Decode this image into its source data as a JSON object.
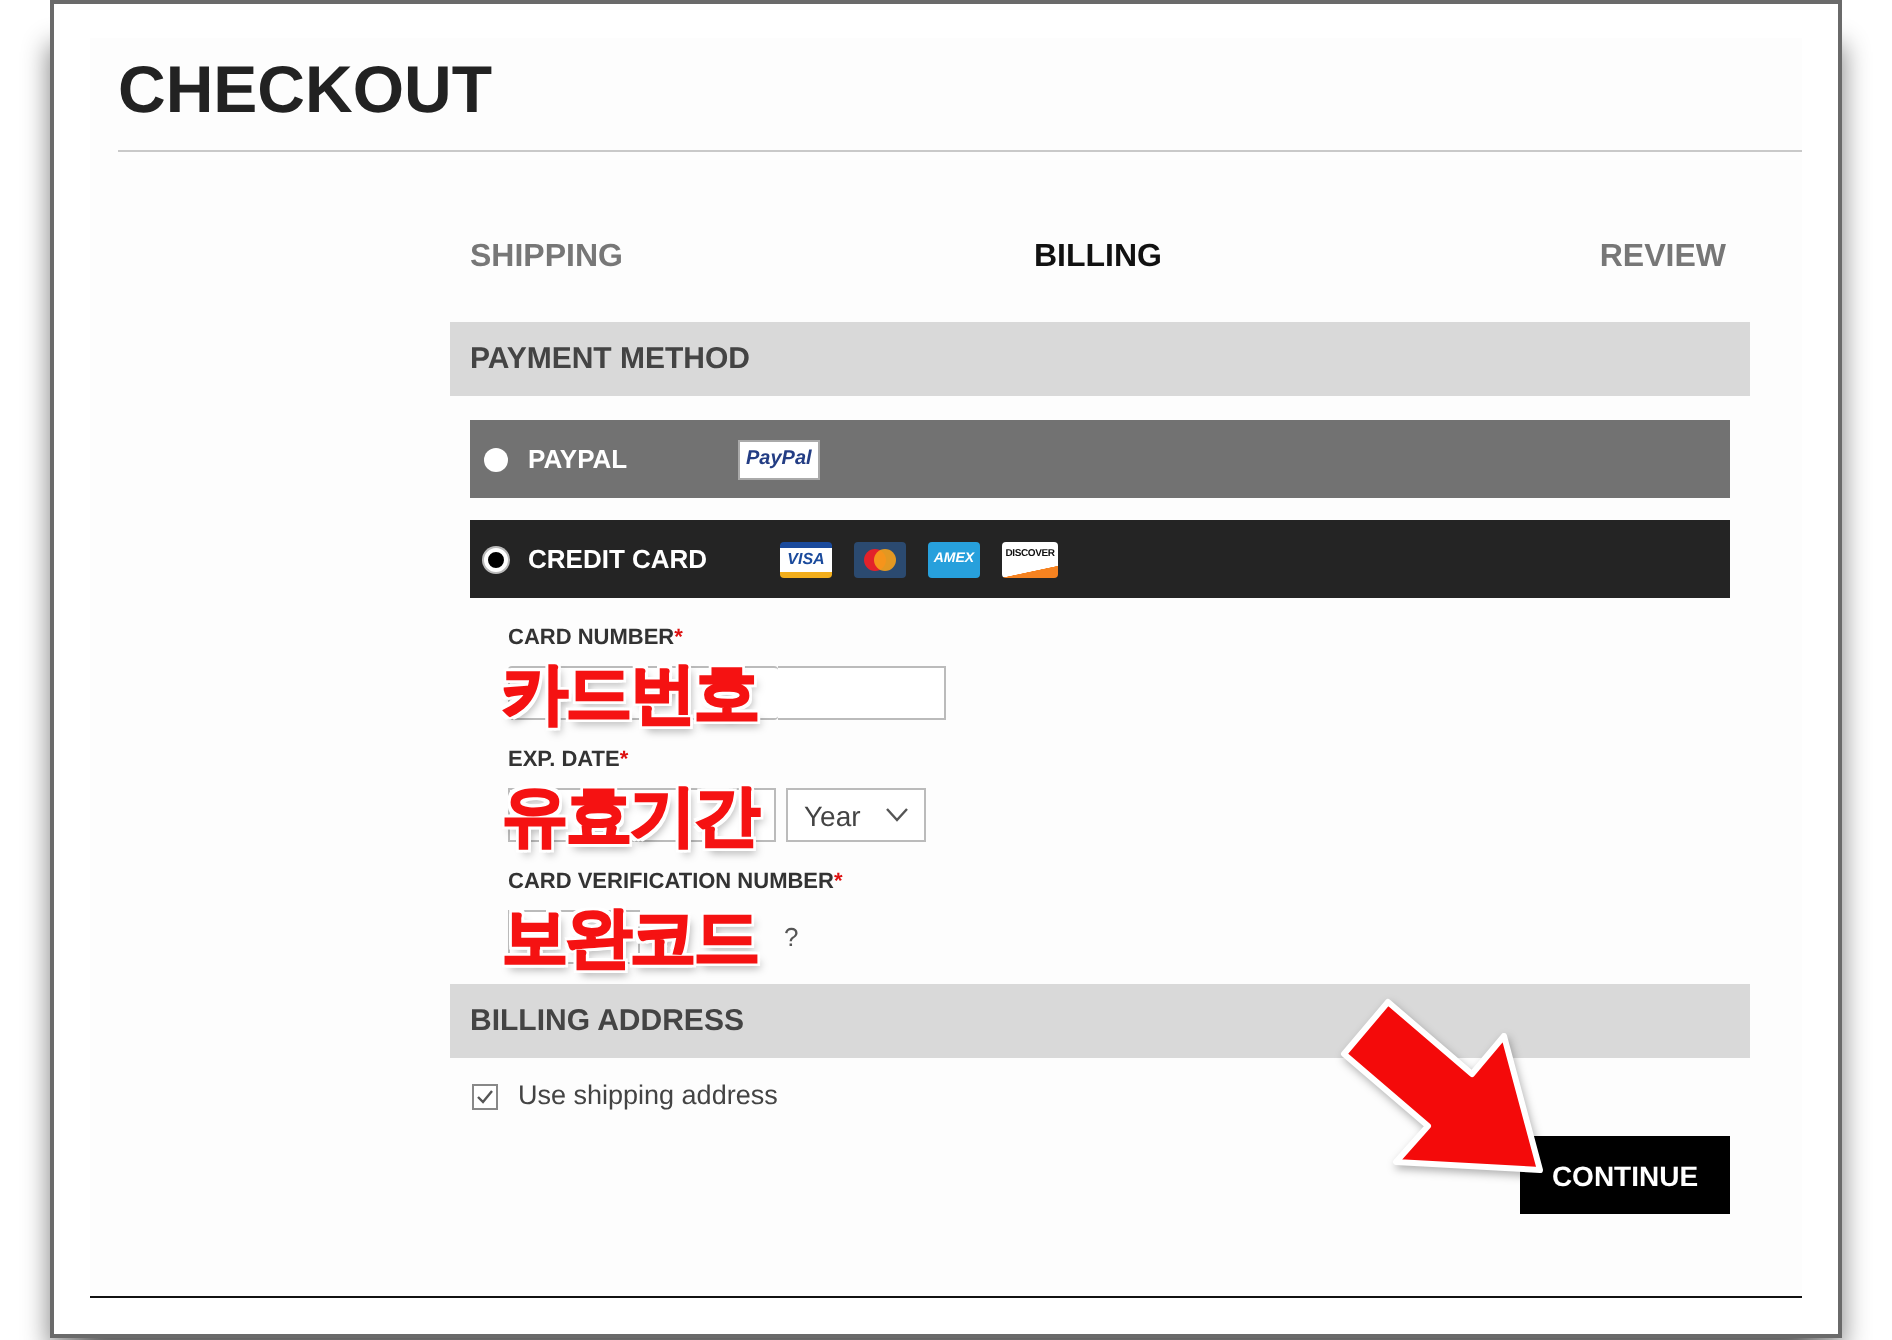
{
  "page": {
    "title": "CHECKOUT"
  },
  "steps": [
    {
      "label": "SHIPPING",
      "selected": false
    },
    {
      "label": "BILLING",
      "selected": true
    },
    {
      "label": "REVIEW",
      "selected": false
    }
  ],
  "payment_method": {
    "heading": "PAYMENT METHOD",
    "options": [
      {
        "kind": "paypal",
        "label": "PAYPAL",
        "selected": false,
        "logo": "PayPal"
      },
      {
        "kind": "card",
        "label": "CREDIT CARD",
        "selected": true,
        "card_logos": [
          {
            "kind": "visa",
            "text": "VISA"
          },
          {
            "kind": "circles"
          },
          {
            "kind": "amex",
            "text": "AMEX"
          },
          {
            "kind": "discover",
            "text": "DISCOVER"
          }
        ]
      }
    ]
  },
  "card_fields": [
    {
      "kind": "text",
      "label": "CARD NUMBER",
      "required_mark": "*",
      "annotation": "카드번호"
    },
    {
      "kind": "date",
      "label": "EXP. DATE",
      "required_mark": "*",
      "annotation": "유효기간",
      "selects": [
        {
          "kind": "month"
        },
        {
          "kind": "year",
          "value": "Year"
        }
      ]
    },
    {
      "kind": "cvv",
      "label": "CARD VERIFICATION NUMBER",
      "required_mark": "*",
      "annotation": "보완코드",
      "help_link": "?"
    }
  ],
  "billing_address": {
    "heading": "BILLING ADDRESS",
    "use_shipping": {
      "label": "Use shipping address",
      "checked": true
    }
  },
  "continue_button": "CONTINUE"
}
